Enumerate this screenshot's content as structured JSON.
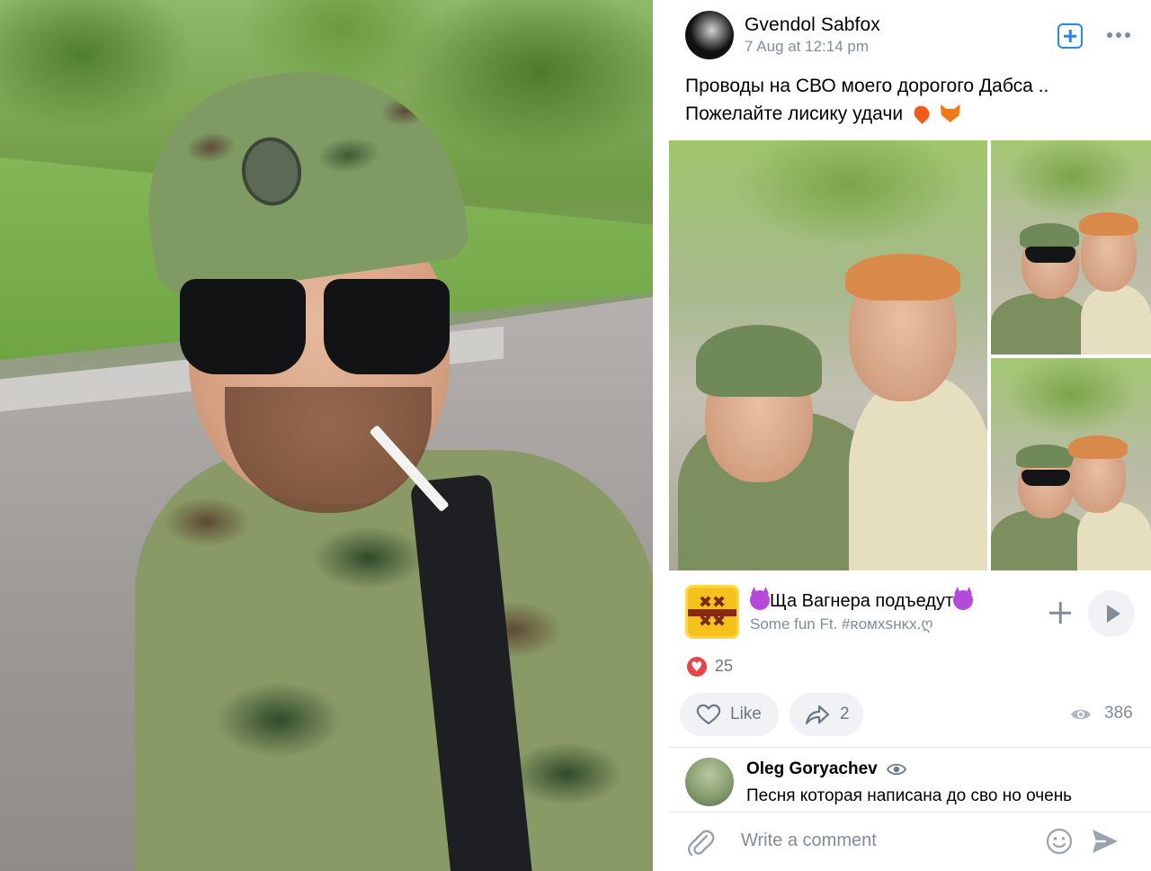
{
  "post": {
    "author": "Gvendol Sabfox",
    "date": "7 Aug at 12:14 pm",
    "text_line1": "Проводы на СВО моего дорогого Дабса ..",
    "text_line2": "Пожелайте лисику удачи"
  },
  "icons": {
    "add": "add-square-icon",
    "more": "more-horizontal-icon",
    "like": "heart-outline-icon",
    "share": "share-arrow-icon",
    "views": "eye-icon",
    "attach": "paperclip-icon",
    "emoji": "smile-icon",
    "send": "send-icon"
  },
  "music": {
    "title": "Ща Вагнера подъедут",
    "artist": "Some fun Ft. #ʀᴏᴍxꜱнᴋx.ღ"
  },
  "reactions": {
    "count": "25"
  },
  "actions": {
    "like_label": "Like",
    "share_count": "2",
    "views_count": "386"
  },
  "comment": {
    "author": "Oleg Goryachev",
    "text": "Песня которая написана до сво но очень"
  },
  "comment_input": {
    "placeholder": "Write a comment"
  },
  "colors": {
    "accent": "#2688eb",
    "secondary_text": "#818c99",
    "like_red": "#e64646",
    "pill_bg": "#f0f2f5"
  }
}
